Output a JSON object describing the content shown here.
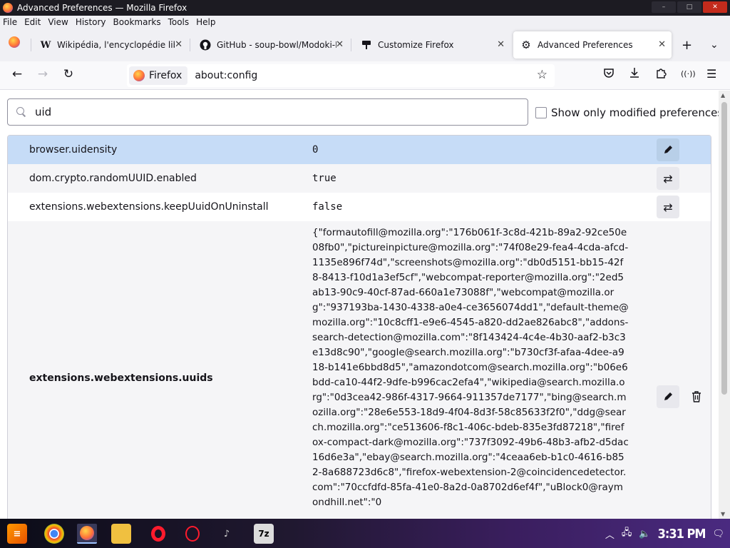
{
  "window": {
    "title": "Advanced Preferences — Mozilla Firefox"
  },
  "menu": [
    "File",
    "Edit",
    "View",
    "History",
    "Bookmarks",
    "Tools",
    "Help"
  ],
  "tabs": [
    {
      "label": "Wikipédia, l'encyclopédie libre",
      "icon": "wikipedia-w"
    },
    {
      "label": "GitHub - soup-bowl/Modoki-Fi",
      "icon": "github-icon"
    },
    {
      "label": "Customize Firefox",
      "icon": "brush-icon"
    },
    {
      "label": "Advanced Preferences",
      "icon": "gear-icon"
    }
  ],
  "navbar": {
    "identity_label": "Firefox",
    "url": "about:config"
  },
  "config": {
    "search_value": "uid",
    "modified_only_label": "Show only modified preferences",
    "prefs": [
      {
        "name": "browser.uidensity",
        "value": "0"
      },
      {
        "name": "dom.crypto.randomUUID.enabled",
        "value": "true"
      },
      {
        "name": "extensions.webextensions.keepUuidOnUninstall",
        "value": "false"
      },
      {
        "name": "extensions.webextensions.uuids",
        "value": "{\"formautofill@mozilla.org\":\"176b061f-3c8d-421b-89a2-92ce50e08fb0\",\"pictureinpicture@mozilla.org\":\"74f08e29-fea4-4cda-afcd-1135e896f74d\",\"screenshots@mozilla.org\":\"db0d5151-bb15-42f8-8413-f10d1a3ef5cf\",\"webcompat-reporter@mozilla.org\":\"2ed5ab13-90c9-40cf-87ad-660a1e73088f\",\"webcompat@mozilla.org\":\"937193ba-1430-4338-a0e4-ce3656074dd1\",\"default-theme@mozilla.org\":\"10c8cff1-e9e6-4545-a820-dd2ae826abc8\",\"addons-search-detection@mozilla.com\":\"8f143424-4c4e-4b30-aaf2-b3c3e13d8c90\",\"google@search.mozilla.org\":\"b730cf3f-afaa-4dee-a918-b141e6bbd8d5\",\"amazondotcom@search.mozilla.org\":\"b06e6bdd-ca10-44f2-9dfe-b996cac2efa4\",\"wikipedia@search.mozilla.org\":\"0d3cea42-986f-4317-9664-911357de7177\",\"bing@search.mozilla.org\":\"28e6e553-18d9-4f04-8d3f-58c85633f2f0\",\"ddg@search.mozilla.org\":\"ce513606-f8c1-406c-bdeb-835e3fd87218\",\"firefox-compact-dark@mozilla.org\":\"737f3092-49b6-48b3-afb2-d5dac16d6e3a\",\"ebay@search.mozilla.org\":\"4ceaa6eb-b1c0-4616-b852-8a688723d6c8\",\"firefox-webextension-2@coincidencedetector.com\":\"70ccfdfd-85fa-41e0-8a2d-0a8702d6ef4f\",\"uBlock0@raymondhill.net\":\"0"
      }
    ]
  },
  "taskbar": {
    "clock": "3:31 PM"
  },
  "colors": {
    "selected_row": "#c6dcf7",
    "titlebar": "#1c1b22"
  }
}
